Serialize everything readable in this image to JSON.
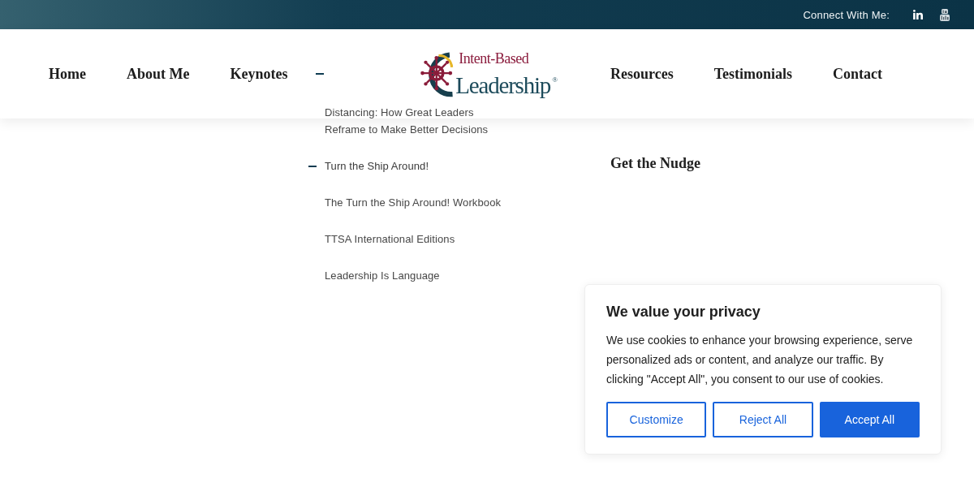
{
  "top_bar": {
    "label": "Connect With Me:"
  },
  "nav": {
    "left": [
      {
        "label": "Home"
      },
      {
        "label": "About Me"
      },
      {
        "label": "Keynotes"
      }
    ],
    "submenu_toggle": {
      "expanded": true
    },
    "logo": {
      "line_1": "Intent-Based",
      "line_2": "Leadership$^{®}$"
    },
    "right": [
      {
        "label": "Resources"
      },
      {
        "label": "Testimonials"
      },
      {
        "label": "Contact"
      }
    ]
  },
  "submenu": {
    "items": [
      {
        "label": "Distancing: How Great Leaders Reframe to Make Better Decisions",
        "expanded": false
      },
      {
        "label": "Turn the Ship Around!",
        "expanded": true
      },
      {
        "label": "The Turn the Ship Around! Workbook",
        "expanded": false
      },
      {
        "label": "TTSA International Editions",
        "expanded": false
      },
      {
        "label": "Leadership Is Language",
        "expanded": false
      }
    ]
  },
  "sidebar": {
    "heading": "Get the Nudge"
  },
  "cookie_banner": {
    "title": "We value your privacy",
    "text": "We use cookies to enhance your browsing experience, serve personalized ads or content, and analyze our traffic. By clicking \"Accept All\", you consent to our use of cookies.",
    "buttons": [
      {
        "label": "Customize",
        "kind": "outline"
      },
      {
        "label": "Reject All",
        "kind": "outline"
      },
      {
        "label": "Accept All",
        "kind": "primary"
      }
    ]
  }
}
